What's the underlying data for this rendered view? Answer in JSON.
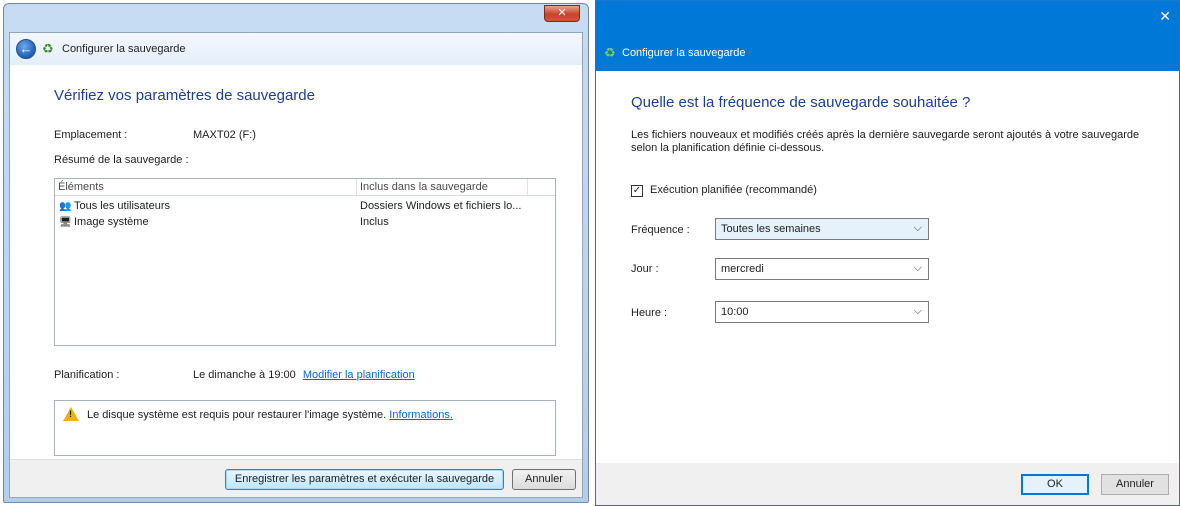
{
  "left_dialog": {
    "close_label": "✕",
    "header_title": "Configurer la sauvegarde",
    "heading": "Vérifiez vos paramètres de sauvegarde",
    "location_label": "Emplacement :",
    "location_value": "MAXT02 (F:)",
    "summary_label": "Résumé de la sauvegarde :",
    "columns": [
      "Éléments",
      "Inclus dans la sauvegarde"
    ],
    "rows": [
      {
        "icon": "users-icon",
        "item": "Tous les utilisateurs",
        "included": "Dossiers Windows et fichiers lo..."
      },
      {
        "icon": "system-image-icon",
        "item": "Image système",
        "included": "Inclus"
      }
    ],
    "schedule_label": "Planification :",
    "schedule_value": "Le dimanche à 19:00",
    "schedule_link": "Modifier la planification",
    "info_text": "Le disque système est requis pour restaurer l'image système.",
    "info_link": "Informations.",
    "save_button": "Enregistrer les paramètres et exécuter la sauvegarde",
    "cancel_button": "Annuler"
  },
  "right_dialog": {
    "close_label": "✕",
    "window_title": "Configurer la sauvegarde",
    "heading": "Quelle est la fréquence de sauvegarde souhaitée ?",
    "description": "Les fichiers nouveaux et modifiés créés après la dernière sauvegarde seront ajoutés à votre sauvegarde selon la planification définie ci-dessous.",
    "scheduled_checkbox": {
      "label": "Exécution planifiée (recommandé)",
      "checked": true
    },
    "frequency_label": "Fréquence :",
    "frequency_value": "Toutes les semaines",
    "day_label": "Jour :",
    "day_value": "mercredi",
    "time_label": "Heure :",
    "time_value": "10:00",
    "ok_button": "OK",
    "cancel_button": "Annuler"
  },
  "colors": {
    "heading_blue": "#1e3f8f",
    "link_blue": "#0c64c8",
    "titlebar_blue": "#0078d7"
  }
}
